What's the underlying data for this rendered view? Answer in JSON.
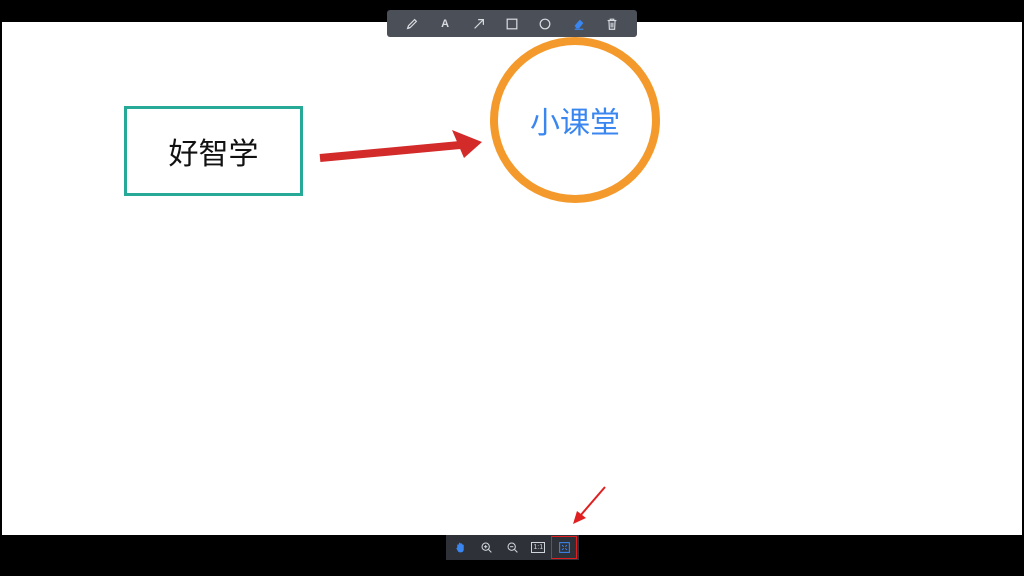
{
  "canvas": {
    "rectangle_text": "好智学",
    "circle_text": "小课堂",
    "colors": {
      "rectangle_border": "#26a996",
      "circle_border": "#f49a2c",
      "circle_text": "#3a86f0",
      "arrow": "#d32a2a",
      "annotation_arrow": "#e02020"
    }
  },
  "top_toolbar": {
    "tools": [
      {
        "name": "pencil-icon",
        "active": false
      },
      {
        "name": "text-tool",
        "glyph": "A",
        "active": false
      },
      {
        "name": "arrow-icon",
        "active": false
      },
      {
        "name": "rectangle-icon",
        "active": false
      },
      {
        "name": "circle-icon",
        "active": false
      },
      {
        "name": "eraser-icon",
        "active": true
      },
      {
        "name": "trash-icon",
        "active": false
      }
    ]
  },
  "bottom_toolbar": {
    "buttons": [
      {
        "name": "hand-icon",
        "active": true
      },
      {
        "name": "zoom-in-icon"
      },
      {
        "name": "zoom-out-icon"
      },
      {
        "name": "actual-size-button",
        "glyph": "1:1"
      },
      {
        "name": "fit-screen-icon",
        "highlighted": true
      }
    ]
  }
}
